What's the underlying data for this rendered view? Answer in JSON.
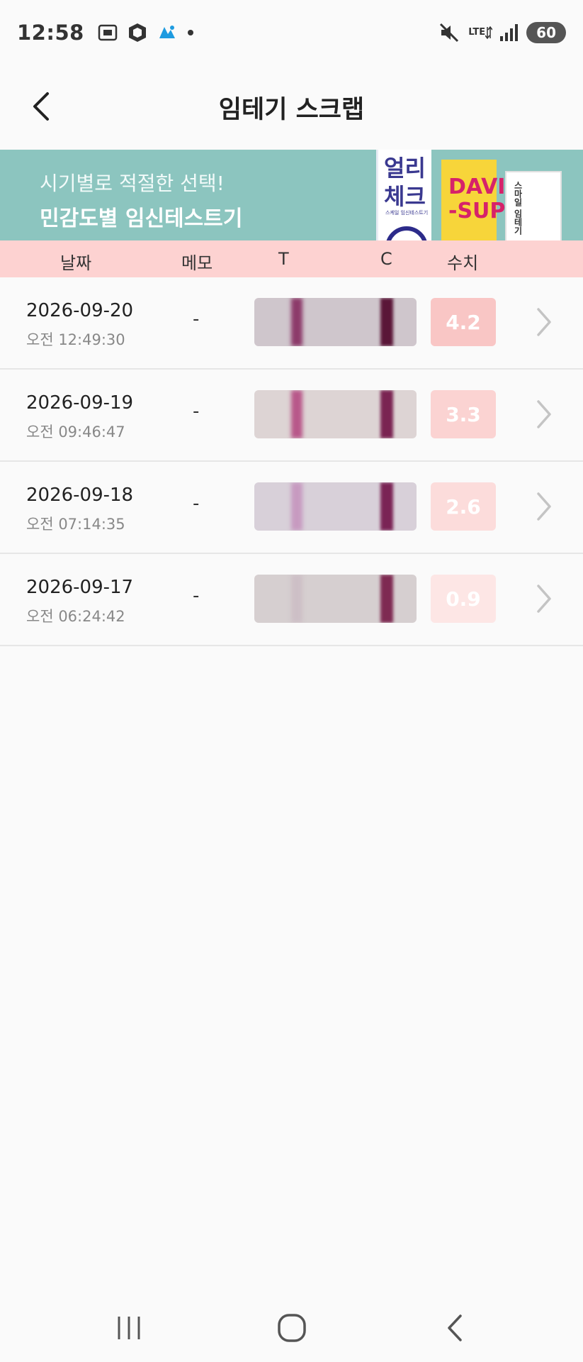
{
  "status_bar": {
    "time": "12:58",
    "network": "LTE",
    "battery": "60"
  },
  "app_bar": {
    "title": "임테기 스크랩"
  },
  "banner": {
    "line1": "시기별로 적절한 선택!",
    "line2": "민감도별 임신테스트기",
    "products": [
      {
        "name": "얼리\n체크",
        "sub": "스케일 임신테스트기",
        "color": "#3a3990"
      },
      {
        "name": "DAVID\n-SUPE",
        "color": "#d6226a"
      },
      {
        "name": "스마일 임테기",
        "color": "#333333"
      }
    ]
  },
  "table": {
    "headers": {
      "date": "날짜",
      "memo": "메모",
      "t": "T",
      "c": "C",
      "value": "수치"
    },
    "rows": [
      {
        "date": "2026-09-20",
        "time": "오전 12:49:30",
        "memo": "-",
        "value": "4.2",
        "badge_color": "#f9c6c5",
        "strip_bg": "#cfc6cc",
        "t_line_color": "#8c3a6a",
        "c_line_color": "#5a1638"
      },
      {
        "date": "2026-09-19",
        "time": "오전 09:46:47",
        "memo": "-",
        "value": "3.3",
        "badge_color": "#fbd3d2",
        "strip_bg": "#ddd4d4",
        "t_line_color": "#b8588a",
        "c_line_color": "#7a2452"
      },
      {
        "date": "2026-09-18",
        "time": "오전 07:14:35",
        "memo": "-",
        "value": "2.6",
        "badge_color": "#fcdcdb",
        "strip_bg": "#d8d0d9",
        "t_line_color": "#c79ac0",
        "c_line_color": "#7a2455"
      },
      {
        "date": "2026-09-17",
        "time": "오전 06:24:42",
        "memo": "-",
        "value": "0.9",
        "badge_color": "#fde6e5",
        "strip_bg": "#d6cfd0",
        "t_line_color": "#cdbfc6",
        "c_line_color": "#7e2a52"
      }
    ]
  }
}
